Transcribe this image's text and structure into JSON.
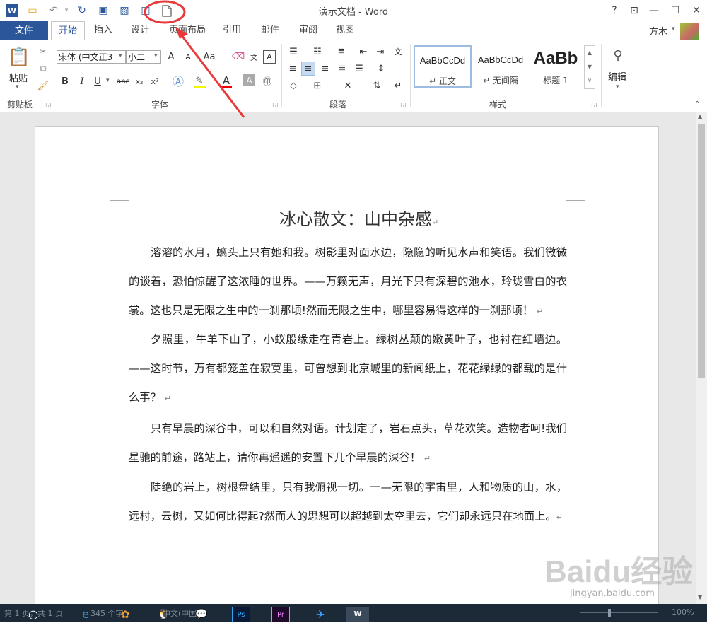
{
  "window": {
    "title": "演示文档 - Word",
    "controls": {
      "help": "?",
      "ribbon_display": "⊡",
      "minimize": "—",
      "maximize": "☐",
      "close": "✕"
    }
  },
  "quick_access": {
    "icons": [
      "word-logo-icon",
      "open-folder-icon",
      "undo-icon",
      "redo-icon",
      "save-icon",
      "save-as-icon",
      "print-preview-icon",
      "new-document-icon"
    ]
  },
  "menu": {
    "file": "文件",
    "tabs": [
      "开始",
      "插入",
      "设计",
      "页面布局",
      "引用",
      "邮件",
      "审阅",
      "视图"
    ],
    "active_tab": "开始",
    "user": "方木"
  },
  "ribbon": {
    "clipboard": {
      "label": "剪贴板",
      "paste": "粘贴"
    },
    "font": {
      "label": "字体",
      "font_name": "宋体 (中文正3",
      "font_size": "小二",
      "grow": "A",
      "shrink": "A",
      "case": "Aa",
      "bold": "B",
      "italic": "I",
      "underline": "U",
      "strike": "abc",
      "subscript": "x₂",
      "superscript": "x²"
    },
    "paragraph": {
      "label": "段落"
    },
    "styles": {
      "label": "样式",
      "tiles": [
        {
          "sample": "AaBbCcDd",
          "name": "↵ 正文"
        },
        {
          "sample": "AaBbCcDd",
          "name": "↵ 无间隔"
        },
        {
          "sample": "AaBb",
          "name": "标题 1"
        }
      ]
    },
    "editing": {
      "label": "编辑"
    }
  },
  "document": {
    "heading": "冰心散文：山中杂感",
    "paragraphs": [
      "溶溶的水月，螭头上只有她和我。树影里对面水边，隐隐的听见水声和笑语。我们微微的谈着，恐怕惊醒了这浓睡的世界。——万籁无声，月光下只有深碧的池水，玲珑雪白的衣裳。这也只是无限之生中的一刹那顷!然而无限之生中，哪里容易得这样的一刹那顷！",
      "夕照里，牛羊下山了，小蚁般缘走在青岩上。绿树丛颠的嫩黄叶子，也衬在红墙边。——这时节，万有都笼盖在寂寞里，可曾想到北京城里的新闻纸上，花花绿绿的都载的是什么事？",
      "只有早晨的深谷中，可以和自然对语。计划定了，岩石点头，草花欢笑。造物者呵!我们星驰的前途，路站上，请你再遥遥的安置下几个早晨的深谷！",
      "陡绝的岩上，树根盘结里，只有我俯视一切。一—无限的宇宙里，人和物质的山，水，远村，云树，又如何比得起?然而人的思想可以超越到太空里去，它们却永远只在地面上。"
    ]
  },
  "statusbar": {
    "page": "第 1 页，共 1 页",
    "words": "345 个字",
    "language": "中文(中国)",
    "zoom": "100%"
  },
  "taskbar": {
    "items": [
      "search-icon",
      "edge-icon",
      "photos-icon",
      "qq-icon",
      "wechat-icon",
      "photoshop-icon",
      "premiere-icon",
      "feishu-icon",
      "word-icon"
    ],
    "ps_label": "Ps",
    "pr_label": "Pr",
    "word_label": "W"
  },
  "watermark": {
    "logo": "Baidu经验",
    "url": "jingyan.baidu.com"
  },
  "colors": {
    "accent": "#2b579a",
    "annotation": "#e8393b"
  }
}
